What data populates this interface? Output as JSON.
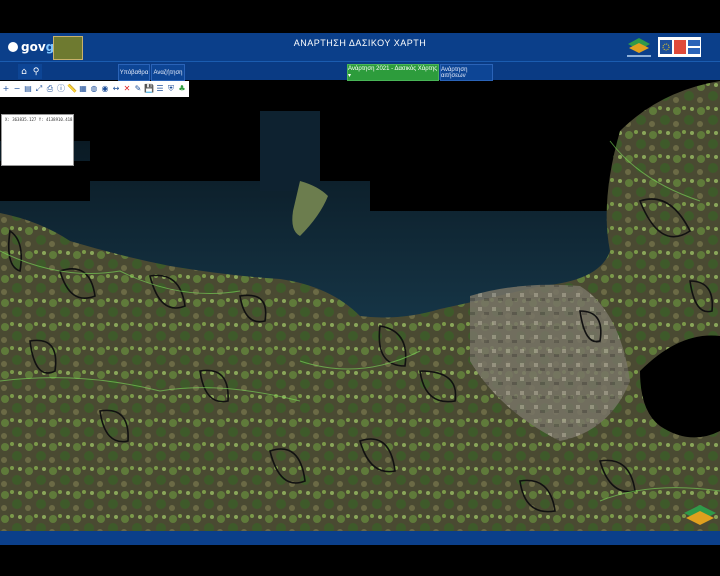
{
  "header": {
    "logo_text": "gov",
    "logo_suffix": "gr",
    "title": "ΑΝΑΡΤΗΣΗ ΔΑΣΙΚΟΥ ΧΑΡΤΗ"
  },
  "nav": {
    "home_icon": "home-icon",
    "search_icon": "search-icon",
    "btn1": "Υπόβαθρα",
    "btn2": "Αναζήτηση",
    "btn3": "Ανάρτηση 2021 - Δασικός Χάρτης ▾",
    "btn4": "Ανάρτηση αιτήσεων"
  },
  "toolbar": {
    "tools": [
      "zoom-in-icon",
      "zoom-out-icon",
      "layers-icon",
      "extent-icon",
      "print-icon",
      "info-icon",
      "measure-icon",
      "grid-icon",
      "globe-icon",
      "globe2-icon",
      "ruler-icon",
      "close-icon",
      "pen-icon",
      "save-icon",
      "list-icon",
      "shield-icon",
      "tree-icon"
    ]
  },
  "legend": {
    "text": "X: 363835.127 Y: 4138910.418"
  },
  "colors": {
    "header_bg": "#0b3f8a",
    "nav_green": "#2d9c3c"
  }
}
